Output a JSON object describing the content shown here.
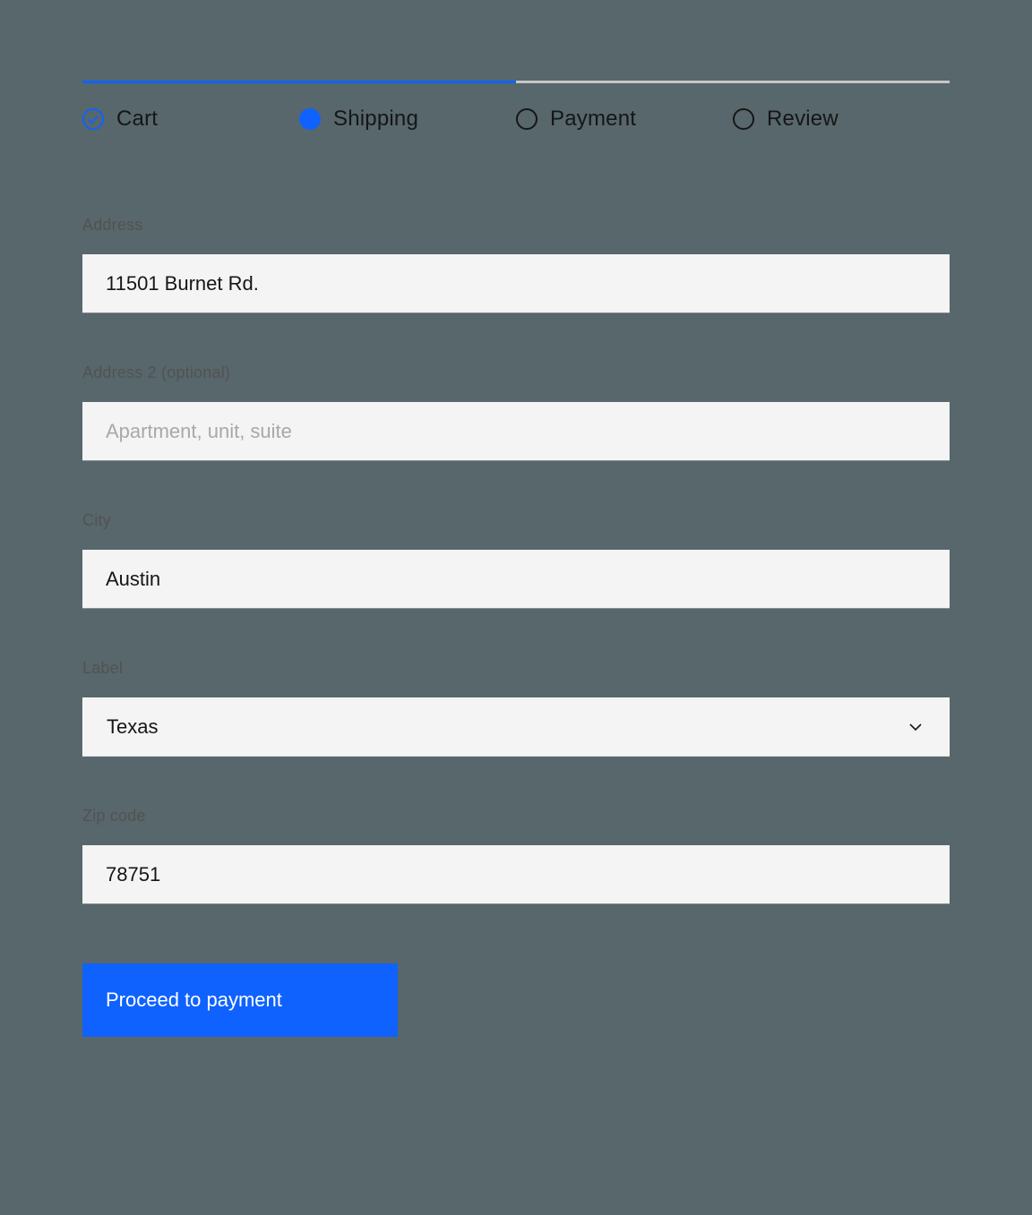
{
  "progress": {
    "steps": [
      {
        "label": "Cart",
        "state": "complete"
      },
      {
        "label": "Shipping",
        "state": "current"
      },
      {
        "label": "Payment",
        "state": "incomplete"
      },
      {
        "label": "Review",
        "state": "incomplete"
      }
    ]
  },
  "form": {
    "address": {
      "label": "Address",
      "value": "11501 Burnet Rd."
    },
    "address2": {
      "label": "Address 2 (optional)",
      "value": "",
      "placeholder": "Apartment, unit, suite"
    },
    "city": {
      "label": "City",
      "value": "Austin"
    },
    "state": {
      "label": "Label",
      "value": "Texas"
    },
    "zip": {
      "label": "Zip code",
      "value": "78751"
    }
  },
  "button": {
    "proceed": "Proceed to payment"
  }
}
